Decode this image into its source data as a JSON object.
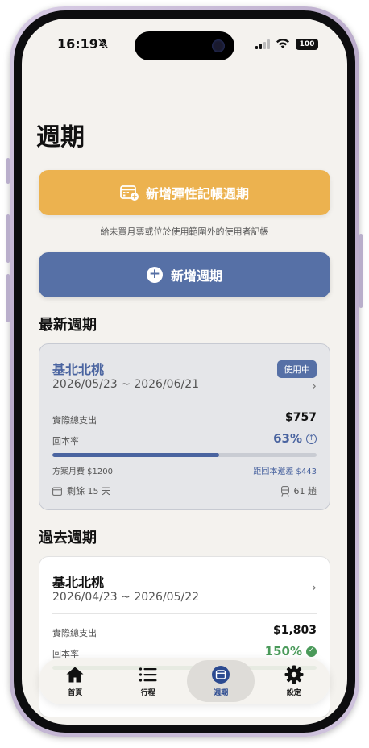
{
  "status_bar": {
    "time": "16:19",
    "battery": "100"
  },
  "header": {
    "title": "週期"
  },
  "flex_period_button": {
    "label": "新增彈性記帳週期"
  },
  "flex_note": "給未買月票或位於使用範圍外的使用者記帳",
  "add_period_button": {
    "label": "新增週期"
  },
  "latest": {
    "section_title": "最新週期",
    "route": "基北北桃",
    "status_badge": "使用中",
    "dates": "2026/05/23 ~ 2026/06/21",
    "total_label": "實際總支出",
    "total_value": "$757",
    "rate_label": "回本率",
    "rate_value": "63%",
    "progress": 0.63,
    "plan_label": "方案月費 $1200",
    "remaining_label": "距回本還差 $443",
    "days_left": "剩餘 15 天",
    "trips": "61 趟"
  },
  "past": {
    "section_title": "過去週期",
    "route": "基北北桃",
    "dates": "2026/04/23 ~ 2026/05/22",
    "total_label": "實際總支出",
    "total_value": "$1,803",
    "rate_label": "回本率",
    "rate_value": "150%",
    "progress": 1.0
  },
  "tabs": [
    {
      "label": "首頁",
      "icon": "home-icon"
    },
    {
      "label": "行程",
      "icon": "list-icon"
    },
    {
      "label": "週期",
      "icon": "calendar-icon"
    },
    {
      "label": "設定",
      "icon": "gear-icon"
    }
  ],
  "colors": {
    "accent_orange": "#ecb24f",
    "accent_blue": "#5670a6",
    "success_green": "#4a9a5a",
    "background": "#f4f2ee"
  }
}
